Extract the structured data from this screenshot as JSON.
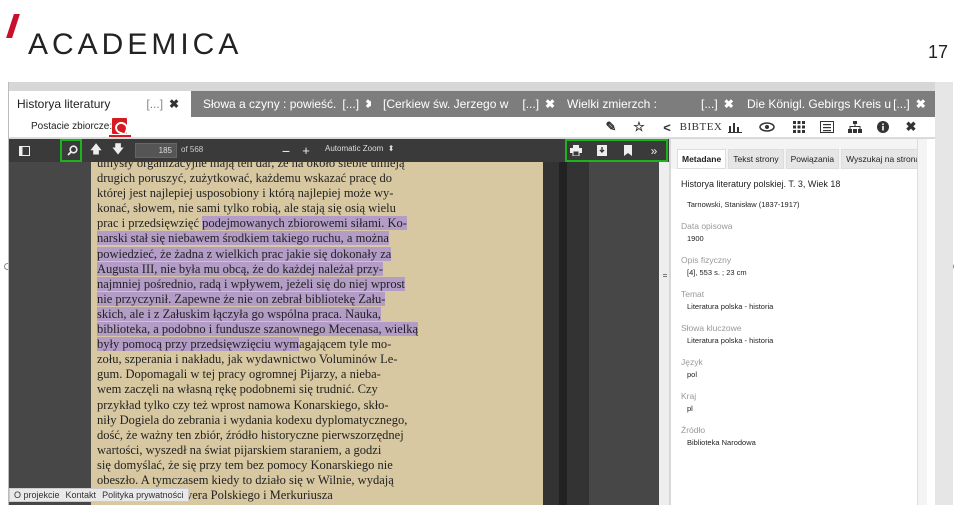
{
  "slide": {
    "logo_text": "ACADEMICA",
    "page_number": "17"
  },
  "tabs": [
    {
      "title": "Historya literatury",
      "ellipsis": "[...]",
      "close": "✖"
    },
    {
      "title": "Słowa a czyny : powieść.",
      "ellipsis": "[...]",
      "close": "✖"
    },
    {
      "title": "[Cerkiew św. Jerzego w",
      "ellipsis": "[...]",
      "close": "✖"
    },
    {
      "title": "Wielki zmierzch :",
      "ellipsis": "[...]",
      "close": "✖"
    },
    {
      "title": "Die Königl. Gebirgs Kreis u",
      "ellipsis": "[...]",
      "close": "✖"
    }
  ],
  "subbar": {
    "postacie_label": "Postacie zbiorcze:",
    "bibtex_label": "BIBTEX"
  },
  "pdf_toolbar": {
    "page_current": "185",
    "page_total_label": "of 568",
    "zoom_label": "Automatic Zoom"
  },
  "pdf_text_lines": [
    {
      "pre": "umysły organizacyjne mają ten dar, że na około siebie umieją",
      "hl": "",
      "post": ""
    },
    {
      "pre": "drugich poruszyć, zużytkować, każdemu wskazać pracę do",
      "hl": "",
      "post": ""
    },
    {
      "pre": "której jest najlepiej usposobiony i którą najlepiej może wy-",
      "hl": "",
      "post": ""
    },
    {
      "pre": "konać, słowem, nie sami tylko robią, ale stają się osią wielu",
      "hl": "",
      "post": ""
    },
    {
      "pre": "prac i przedsięwzięć ",
      "hl": "podejmowanych zbiorowemi siłami. Ko-",
      "post": ""
    },
    {
      "pre": "",
      "hl": "narski stał się niebawem środkiem takiego ruchu, a można",
      "post": ""
    },
    {
      "pre": "",
      "hl": "powiedzieć, że żadna z wielkich prac jakie się dokonały za",
      "post": ""
    },
    {
      "pre": "",
      "hl": "Augusta III, nie była mu obcą, że do każdej należał przy-",
      "post": ""
    },
    {
      "pre": "",
      "hl": "najmniej pośrednio, radą i wpływem, jeżeli się do niej wprost",
      "post": ""
    },
    {
      "pre": "",
      "hl": "nie przyczynił. Zapewne że nie on zebrał bibliotekę Zału-",
      "post": ""
    },
    {
      "pre": "",
      "hl": "skich, ale i z Załuskim łączyła go wspólna praca. Nauka,",
      "post": ""
    },
    {
      "pre": "",
      "hl": "biblioteka, a podobno i fundusze szanownego Mecenasa, wielką",
      "post": ""
    },
    {
      "pre": "",
      "hl": "były pomocą przy przedsięwzięciu wym",
      "post": "agającem tyle mo-"
    },
    {
      "pre": "zołu, szperania i nakładu, jak wydawnictwo Voluminów Le-",
      "hl": "",
      "post": ""
    },
    {
      "pre": "gum. Dopomagali w tej pracy ogromnej Pijarzy, a nieba-",
      "hl": "",
      "post": ""
    },
    {
      "pre": "wem zaczęli na własną rękę podobnemi się trudnić. Czy",
      "hl": "",
      "post": ""
    },
    {
      "pre": "przykład tylko czy też wprost namowa Konarskiego, skło-",
      "hl": "",
      "post": ""
    },
    {
      "pre": "niły Dogiela do zebrania i wydania kodexu dyplomatycznego,",
      "hl": "",
      "post": ""
    },
    {
      "pre": "dość, że ważny ten zbiór, źródło historyczne pierwszorzędnej",
      "hl": "",
      "post": ""
    },
    {
      "pre": "wartości, wyszedł na świat pijarskiem staraniem, a godzi",
      "hl": "",
      "post": ""
    },
    {
      "pre": "się domyślać, że się przy tem bez pomocy Konarskiego nie",
      "hl": "",
      "post": ""
    },
    {
      "pre": "obeszło. A tymczasem kiedy to działo się w Wilnie, wydają",
      "hl": "",
      "post": ""
    },
    {
      "pre": "w Warszawie Kuryera Polskiego i Merkuriusza",
      "hl": "",
      "post": ""
    }
  ],
  "footer": {
    "links": [
      "O projekcie",
      "Kontakt",
      "Polityka prywatności"
    ]
  },
  "meta": {
    "tabs": [
      "Metadane",
      "Tekst strony",
      "Powiązania",
      "Wyszukaj na stronach"
    ],
    "title": "Historya literatury polskiej. T. 3, Wiek 18",
    "author": "Tarnowski, Stanisław (1837-1917)",
    "fields": [
      {
        "label": "Data opisowa",
        "value": "1900"
      },
      {
        "label": "Opis fizyczny",
        "value": "[4], 553 s. ; 23 cm"
      },
      {
        "label": "Temat",
        "value": "Literatura polska - historia"
      },
      {
        "label": "Słowa kluczowe",
        "value": "Literatura polska - historia"
      },
      {
        "label": "Język",
        "value": "pol"
      },
      {
        "label": "Kraj",
        "value": "pl"
      },
      {
        "label": "Źródło",
        "value": "Biblioteka Narodowa"
      }
    ]
  },
  "colors": {
    "highlight": "#9a7fe6",
    "green_frame": "#1db31d",
    "logo_red": "#c8102e",
    "pdf_red": "#d71920"
  }
}
